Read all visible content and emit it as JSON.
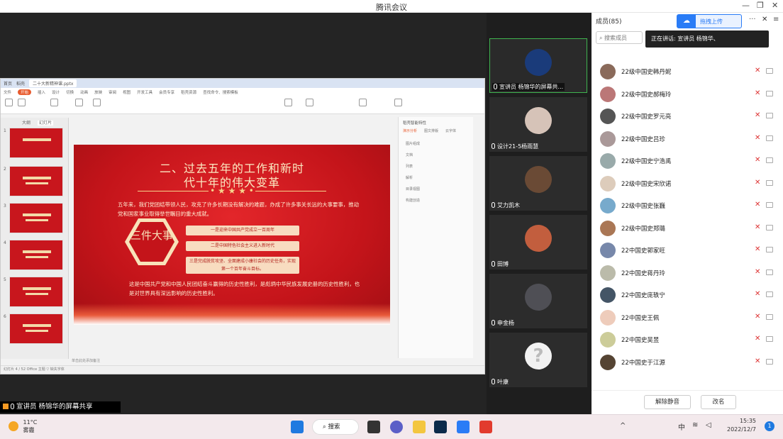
{
  "window": {
    "title": "腾讯会议",
    "minimize": "—",
    "restore": "❐",
    "close": "✕"
  },
  "ppt": {
    "tabs": [
      "首页",
      "稻壳",
      "二十大新精神课.pptx"
    ],
    "menu": [
      "文件",
      "开始",
      "插入",
      "设计",
      "切换",
      "动画",
      "放映",
      "审阅",
      "视图",
      "开发工具",
      "会员专享",
      "稻壳资源",
      "查找命令、搜索模板"
    ],
    "active_menu": "开始",
    "thumb_tabs": [
      "大纲",
      "幻灯片"
    ],
    "slide": {
      "title_line1": "二、过去五年的工作和新时",
      "title_line2": "代十年的伟大变革",
      "stars": "• ★ ★ ★ •",
      "para1": "五年来，我们党团结带领人民，攻克了许多长期没有解决的难题，办成了许多事关长远的大事要事，推动党和国家事业取得举世瞩目的重大成就。",
      "hex_text": "三件大事",
      "box1": "一是迎来中国共产党成立一百周年",
      "box2": "二是中国特色社会主义进入新时代",
      "box3": "三是完成脱贫攻坚、全面建成小康社会的历史任务，实现第一个百年奋斗目标。",
      "para2": "这是中国共产党和中国人民团结奋斗赢得的历史性胜利，是彪炳中华民族发展史册的历史性胜利，也是对世界具有深远影响的历史性胜利。"
    },
    "right_pane": {
      "title": "稻壳智能特性",
      "tabs": [
        "演示分析",
        "图文排版",
        "云字体"
      ],
      "items": [
        "图片组成",
        "文档",
        "列表",
        "解析",
        "目录视图",
        "构建创造"
      ]
    },
    "status": "幻灯片 4 / 52   Office 主题   ▽ 缺失字体",
    "notes": "单击此处添加备注"
  },
  "tiles": [
    {
      "name": "宣讲员  杨锦华的屏幕共..."
    },
    {
      "name": "设计21-5杨雨慧"
    },
    {
      "name": "艾力凯木"
    },
    {
      "name": "田博"
    },
    {
      "name": "申金杨"
    },
    {
      "name": "叶康"
    }
  ],
  "members": {
    "title": "成员(85)",
    "upload_label": "拖拽上传",
    "search_placeholder": "搜索成员",
    "speaking": "正在讲话: 宣讲员  杨锦华、",
    "list": [
      "22级中国史韩丹妮",
      "22级中国史郝梅玲",
      "22级中国史罗元亮",
      "22级中国史吕珍",
      "22级中国史宁浩禹",
      "22级中国史宋欣诺",
      "22级中国史张巍",
      "22级中国史郑璐",
      "22中国史郭家旺",
      "22中国史蒋丹玲",
      "22中国史庞轶宁",
      "22中国史王佩",
      "22中国史吴昱",
      "22中国史于江源"
    ],
    "unmute_all": "解除静音",
    "rename": "改名"
  },
  "share_label": "宣讲员  杨锦华的屏幕共享",
  "taskbar": {
    "temp": "11°C",
    "weather": "雾霾",
    "search": "搜索",
    "time": "15:35",
    "date": "2022/12/7",
    "ime": "中",
    "notif_count": "1"
  }
}
